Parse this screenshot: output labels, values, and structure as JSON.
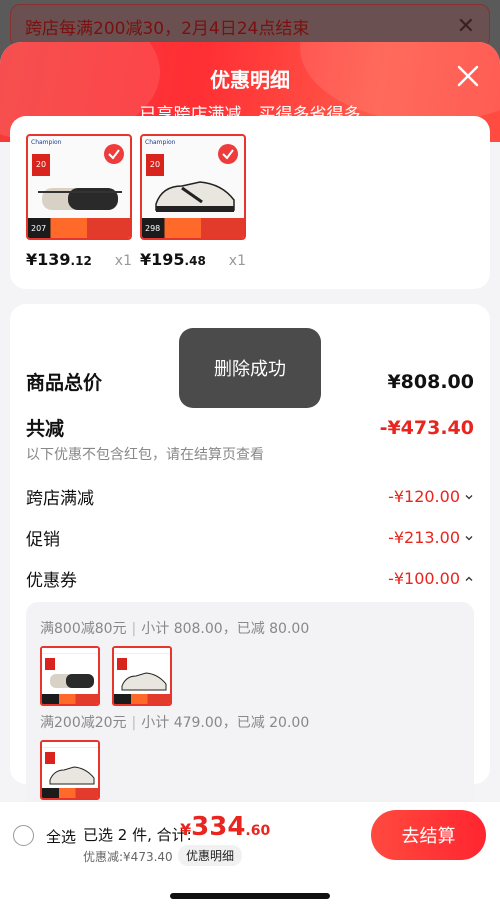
{
  "promo_banner": {
    "text": "跨店每满200减30，2月4日24点结束"
  },
  "sheet": {
    "title": "优惠明细",
    "subtitle": "已享跨店满减，买得多省得多"
  },
  "products": [
    {
      "thumb_price": "207",
      "price_int": "¥139",
      "price_dec": ".12",
      "qty": "x1"
    },
    {
      "thumb_price": "298",
      "price_int": "¥195",
      "price_dec": ".48",
      "qty": "x1"
    }
  ],
  "summary": {
    "total_label": "商品总价",
    "total_value": "¥808.00",
    "discount_label": "共减",
    "discount_value": "-¥473.40",
    "note": "以下优惠不包含红包，请在结算页查看",
    "items": [
      {
        "label": "跨店满减",
        "value": "-¥120.00"
      },
      {
        "label": "促销",
        "value": "-¥213.00"
      },
      {
        "label": "优惠券",
        "value": "-¥100.00"
      }
    ]
  },
  "coupons": [
    {
      "rule": "满800减80元",
      "detail": "小计 808.00，已减 80.00"
    },
    {
      "rule": "满200减20元",
      "detail": "小计 479.00，已减 20.00"
    }
  ],
  "toast": {
    "text": "删除成功"
  },
  "bottom_bar": {
    "select_all": "全选",
    "selected": "已选 2 件, 合计:",
    "currency": "¥",
    "total_int": "334",
    "total_dec": ".60",
    "discount": "优惠减:¥473.40",
    "detail": "优惠明细",
    "checkout": "去结算"
  },
  "colors": {
    "accent": "#ff2f34",
    "price_red": "#e8261f"
  }
}
